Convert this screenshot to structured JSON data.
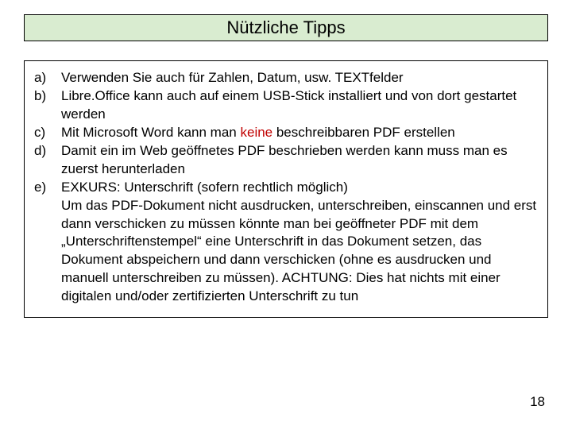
{
  "title": "Nützliche Tipps",
  "tips": [
    {
      "marker": "a)",
      "text": "Verwenden Sie auch für Zahlen, Datum, usw. TEXTfelder"
    },
    {
      "marker": "b)",
      "text": "Libre.Office kann auch auf einem USB-Stick installiert und von dort gestartet werden"
    },
    {
      "marker": "c)",
      "prefix": "Mit Microsoft Word kann man ",
      "emph": "keine",
      "suffix": " beschreibbaren PDF erstellen"
    },
    {
      "marker": "d)",
      "text": "Damit ein im Web geöffnetes PDF beschrieben werden kann muss man es zuerst herunterladen"
    },
    {
      "marker": "e)",
      "text": "EXKURS: Unterschrift (sofern rechtlich möglich)\nUm das PDF-Dokument nicht ausdrucken, unterschreiben, einscannen und erst dann verschicken zu müssen könnte man bei geöffneter PDF mit dem „Unterschriftenstempel“ eine Unterschrift in das Dokument setzen, das Dokument abspeichern und dann verschicken (ohne es ausdrucken und manuell unterschreiben zu müssen). ACHTUNG: Dies hat nichts mit einer digitalen und/oder zertifizierten Unterschrift zu tun"
    }
  ],
  "page_number": "18"
}
